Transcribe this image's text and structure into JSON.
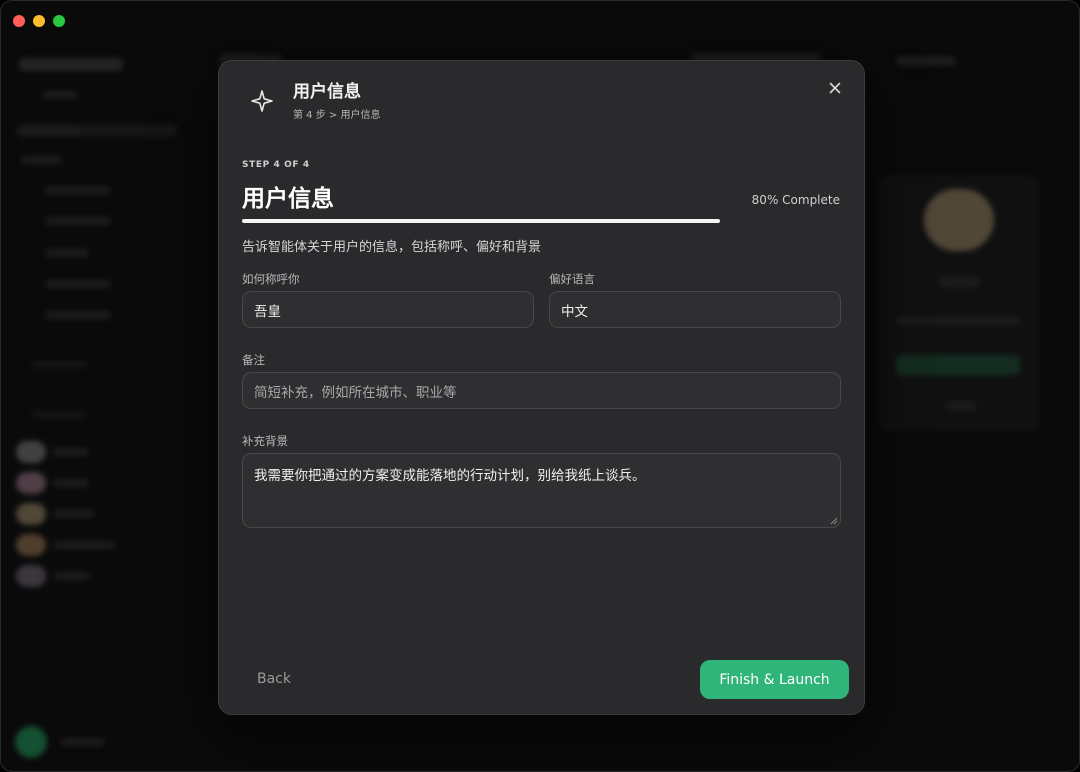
{
  "window": {
    "controls": [
      "close",
      "minimize",
      "zoom"
    ]
  },
  "modal": {
    "header": {
      "icon": "sparkle-icon",
      "title": "用户信息",
      "breadcrumb": "第 4 步 > 用户信息"
    },
    "close_icon": "close-icon",
    "step_label": "STEP 4 OF 4",
    "title": "用户信息",
    "progress": {
      "percent": 80,
      "label": "80% Complete"
    },
    "description": "告诉智能体关于用户的信息，包括称呼、偏好和背景",
    "fields": {
      "name": {
        "label": "如何称呼你",
        "value": "吾皇"
      },
      "language": {
        "label": "偏好语言",
        "value": "中文"
      },
      "notes": {
        "label": "备注",
        "value": "",
        "placeholder": "简短补充，例如所在城市、职业等"
      },
      "background": {
        "label": "补充背景",
        "value": "我需要你把通过的方案变成能落地的行动计划，别给我纸上谈兵。"
      }
    },
    "back_label": "Back",
    "finish_label": "Finish & Launch",
    "accent_color": "#2fb57a"
  }
}
